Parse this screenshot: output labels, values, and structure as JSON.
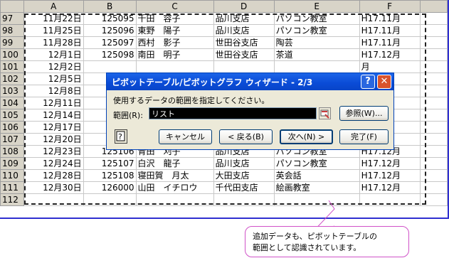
{
  "columns": [
    "A",
    "B",
    "C",
    "D",
    "E",
    "F"
  ],
  "rows": [
    {
      "n": "97",
      "date": "11月22日",
      "code": "125095",
      "name": "千田　容子",
      "branch": "品川支店",
      "course": "パソコン教室",
      "period": "H17.11月"
    },
    {
      "n": "98",
      "date": "11月25日",
      "code": "125096",
      "name": "東野　陽子",
      "branch": "品川支店",
      "course": "パソコン教室",
      "period": "H17.11月"
    },
    {
      "n": "99",
      "date": "11月28日",
      "code": "125097",
      "name": "西村　影子",
      "branch": "世田谷支店",
      "course": "陶芸",
      "period": "H17.11月"
    },
    {
      "n": "100",
      "date": "12月1日",
      "code": "125098",
      "name": "南田　明子",
      "branch": "世田谷支店",
      "course": "茶道",
      "period": "H17.12月"
    },
    {
      "n": "101",
      "date": "12月2日",
      "code": "",
      "name": "",
      "branch": "",
      "course": "",
      "period": "月"
    },
    {
      "n": "102",
      "date": "12月5日",
      "code": "1",
      "name": "",
      "branch": "",
      "course": "",
      "period": "月"
    },
    {
      "n": "103",
      "date": "12月8日",
      "code": "1",
      "name": "",
      "branch": "",
      "course": "",
      "period": "月"
    },
    {
      "n": "104",
      "date": "12月11日",
      "code": "1",
      "name": "",
      "branch": "",
      "course": "",
      "period": "月"
    },
    {
      "n": "105",
      "date": "12月14日",
      "code": "1",
      "name": "",
      "branch": "",
      "course": "",
      "period": "月"
    },
    {
      "n": "106",
      "date": "12月17日",
      "code": "1",
      "name": "",
      "branch": "",
      "course": "",
      "period": "月"
    },
    {
      "n": "107",
      "date": "12月20日",
      "code": "",
      "name": "",
      "branch": "",
      "course": "",
      "period": "月"
    },
    {
      "n": "108",
      "date": "12月23日",
      "code": "125106",
      "name": "青田　刈子",
      "branch": "品川支店",
      "course": "パソコン教室",
      "period": "H17.12月"
    },
    {
      "n": "109",
      "date": "12月24日",
      "code": "125107",
      "name": "白沢　龍子",
      "branch": "品川支店",
      "course": "パソコン教室",
      "period": "H17.12月"
    },
    {
      "n": "110",
      "date": "12月28日",
      "code": "125108",
      "name": "寝田賀　月太",
      "branch": "大田支店",
      "course": "英会話",
      "period": "H17.12月"
    },
    {
      "n": "111",
      "date": "12月30日",
      "code": "126000",
      "name": "山田　イチロウ",
      "branch": "千代田支店",
      "course": "絵画教室",
      "period": "H17.12月"
    },
    {
      "n": "112",
      "date": "",
      "code": "",
      "name": "",
      "branch": "",
      "course": "",
      "period": ""
    }
  ],
  "dialog": {
    "title": "ピボットテーブル/ピボットグラフ ウィザード - 2/3",
    "help_glyph": "?",
    "close_glyph": "✕",
    "prompt": "使用するデータの範囲を指定してください。",
    "range_label": "範囲(R):",
    "range_value": "リスト",
    "browse_label": "参照(W)...",
    "cancel_label": "キャンセル",
    "back_label": "< 戻る(B)",
    "next_label": "次へ(N) >",
    "finish_label": "完了(F)"
  },
  "callout": {
    "line1": "追加データも、ピボットテーブルの",
    "line2": "範囲として認識されています。"
  },
  "colors": {
    "selection_border": "#2f2fd0",
    "callout_border": "#d052c8",
    "titlebar": "#0a4bd6"
  }
}
